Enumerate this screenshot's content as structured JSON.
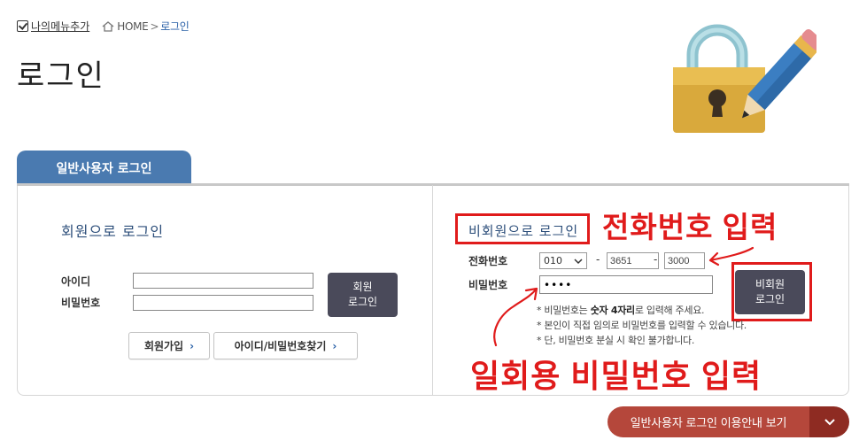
{
  "topbar": {
    "my_menu_label": "나의메뉴추가",
    "breadcrumb": {
      "home": "HOME",
      "separator": ">",
      "current": "로그인"
    }
  },
  "page_title": "로그인",
  "tab": {
    "label": "일반사용자 로그인"
  },
  "member": {
    "title": "회원으로 로그인",
    "id_label": "아이디",
    "password_label": "비밀번호",
    "id_value": "",
    "password_value": "",
    "login_button": [
      "회원",
      "로그인"
    ],
    "signup_label": "회원가입",
    "find_label": "아이디/비밀번호찾기",
    "arrow_glyph": "›"
  },
  "nonmember": {
    "title": "비회원으로 로그인",
    "phone_label": "전화번호",
    "password_label": "비밀번호",
    "phone_prefix": "010",
    "phone_mid": "3651",
    "phone_last": "3000",
    "dash": "-",
    "password_value": "••••",
    "login_button": [
      "비회원",
      "로그인"
    ],
    "notes": {
      "line1_pre": "* 비밀번호는 ",
      "line1_bold": "숫자 4자리",
      "line1_post": "로 입력해 주세요.",
      "line2": "* 본인이 직접 임의로 비밀번호를 입력할 수 있습니다.",
      "line3": "* 단, 비밀번호 분실 시 확인 불가합니다."
    }
  },
  "annotations": {
    "phone": "전화번호 입력",
    "password": "일회용 비밀번호 입력"
  },
  "guide_button": {
    "label": "일반사용자 로그인 이용안내 보기"
  },
  "colors": {
    "accent_blue": "#4a7ab0",
    "title_blue": "#2c4e7a",
    "annotation_red": "#e01b1b",
    "dark_button": "#4a4a5a",
    "guide_red": "#b5473b",
    "guide_dark": "#8e2b22"
  },
  "icons": [
    "check-icon",
    "home-icon",
    "lock-pencil-illustration",
    "chevron-down-icon",
    "chevron-right-icon"
  ]
}
